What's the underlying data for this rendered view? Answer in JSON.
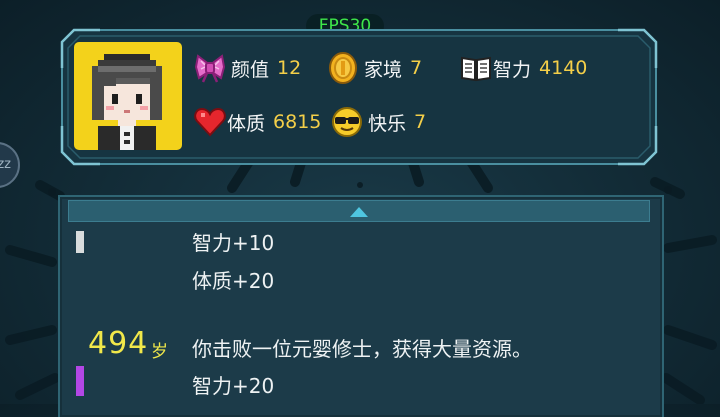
{
  "fps": "FPS30",
  "stats": {
    "looks": {
      "label": "颜值",
      "value": "12",
      "icon": "ribbon-bow-icon"
    },
    "family": {
      "label": "家境",
      "value": "7",
      "icon": "gold-coin-icon"
    },
    "intelligence": {
      "label": "智力",
      "value": "4140",
      "icon": "open-book-icon"
    },
    "constitution": {
      "label": "体质",
      "value": "6815",
      "icon": "red-heart-icon"
    },
    "happiness": {
      "label": "快乐",
      "value": "7",
      "icon": "sunglasses-smiley-icon"
    }
  },
  "log": {
    "prev_entry": {
      "effects": [
        "智力+10",
        "体质+20"
      ]
    },
    "entry": {
      "age": "494",
      "age_unit": "岁",
      "text": "你击败一位元婴修士，获得大量资源。",
      "effects": [
        "智力+20"
      ]
    }
  },
  "side_badge": "zz",
  "colors": {
    "stat_value": "#f4cf49",
    "age": "#f1e84a",
    "fps": "#3ee64a",
    "marker_rare": "#b347e6"
  }
}
